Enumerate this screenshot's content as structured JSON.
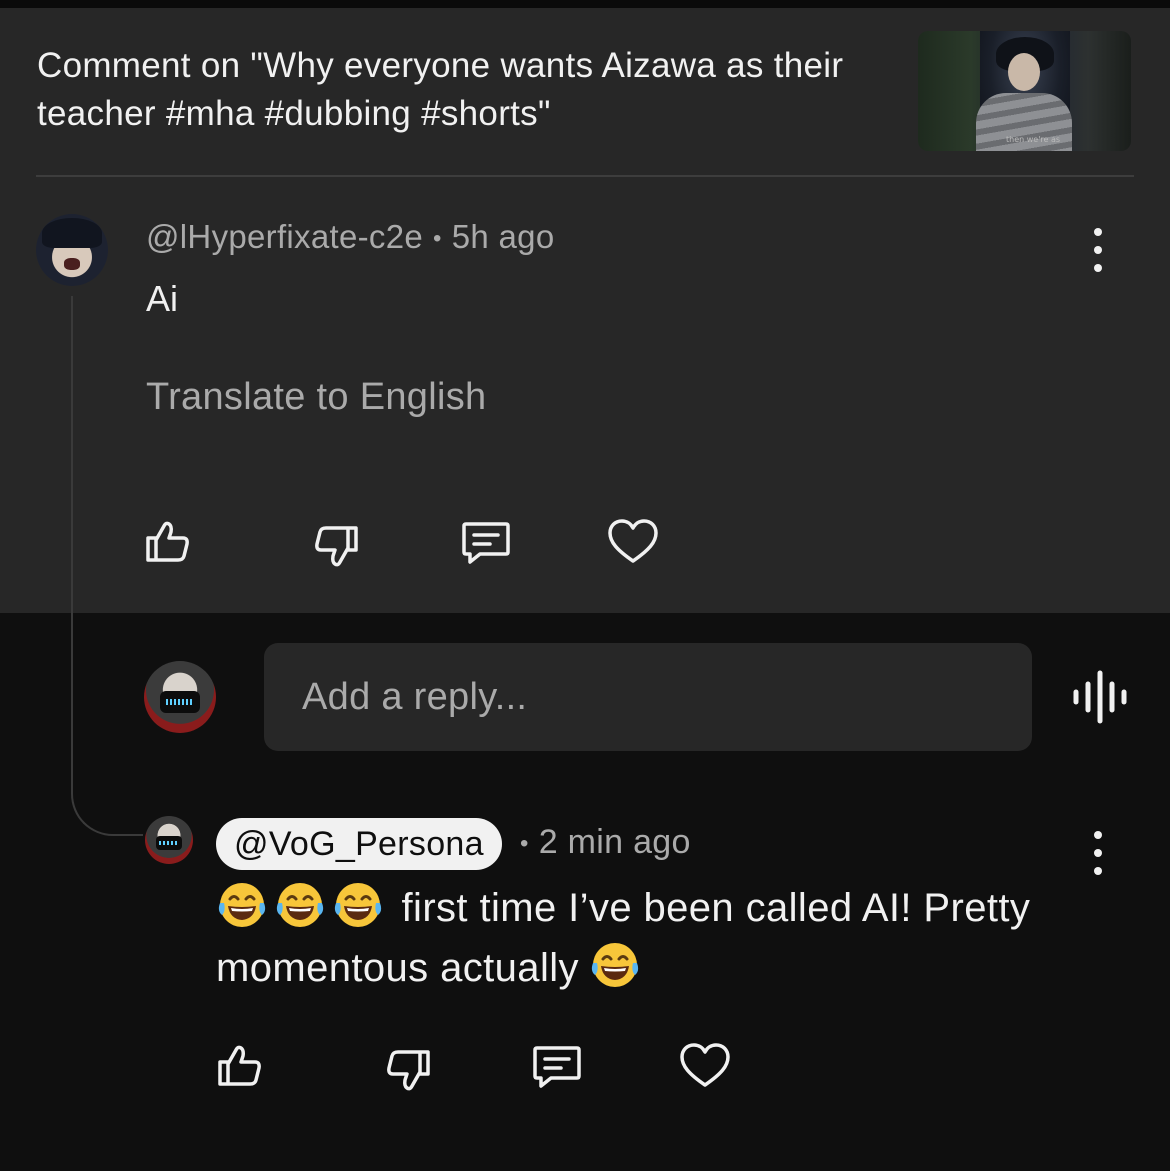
{
  "header": {
    "title": "Comment on \"Why everyone wants Aizawa as their teacher #mha #dubbing #shorts\"",
    "thumbnail_caption": "then we're as"
  },
  "comment": {
    "author": "@lHyperfixate-c2e",
    "separator": "•",
    "time": "5h ago",
    "text": "Ai",
    "translate_label": "Translate to English",
    "actions": [
      "like",
      "dislike",
      "reply",
      "heart"
    ]
  },
  "composer": {
    "placeholder": "Add a reply..."
  },
  "reply": {
    "author": "@VoG_Persona",
    "separator": "•",
    "time": "2 min ago",
    "text_part1": " first time I’ve been called AI! Pretty ",
    "text_part2": "momentous actually",
    "emoji_before": [
      "face-with-tears-of-joy",
      "face-with-tears-of-joy",
      "face-with-tears-of-joy"
    ],
    "emoji_after": [
      "face-with-tears-of-joy"
    ],
    "actions": [
      "like",
      "dislike",
      "reply",
      "heart"
    ]
  },
  "icons": {
    "like": "thumbs-up-icon",
    "dislike": "thumbs-down-icon",
    "reply": "comment-icon",
    "heart": "heart-icon",
    "more": "more-options-icon",
    "voice": "voice-search-icon"
  },
  "colors": {
    "upper_background": "#272727",
    "lower_background": "#0f0f0f",
    "text_primary": "#f1f1f1",
    "text_secondary": "#aaaaaa",
    "input_background": "#272727",
    "pill_background": "#f1f1f1"
  }
}
